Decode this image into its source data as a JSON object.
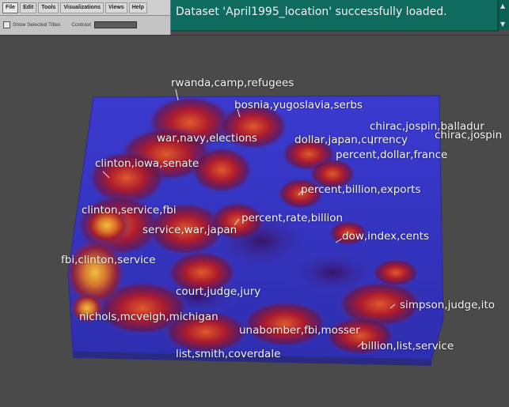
{
  "menubar": {
    "items": [
      {
        "label": "File"
      },
      {
        "label": "Edit"
      },
      {
        "label": "Tools"
      },
      {
        "label": "Visualizations"
      },
      {
        "label": "Views"
      },
      {
        "label": "Help"
      }
    ]
  },
  "options": {
    "show_selected_label": "Show Selected Titles",
    "contrast_label": "Contrast"
  },
  "status": {
    "message": "Dataset 'April1995_location' successfully loaded."
  },
  "scroll": {
    "up_icon": "▲",
    "down_icon": "▼"
  },
  "map": {
    "labels": [
      {
        "text": "rwanda,camp,refugees"
      },
      {
        "text": "bosnia,yugoslavia,serbs"
      },
      {
        "text": "chirac,jospin,balladur"
      },
      {
        "text": "chirac,jospin"
      },
      {
        "text": "war,navy,elections"
      },
      {
        "text": "dollar,japan,currency"
      },
      {
        "text": "percent,dollar,france"
      },
      {
        "text": "clinton,iowa,senate"
      },
      {
        "text": "percent,billion,exports"
      },
      {
        "text": "clinton,service,fbi"
      },
      {
        "text": "percent,rate,billion"
      },
      {
        "text": "service,war,japan"
      },
      {
        "text": "dow,index,cents"
      },
      {
        "text": "fbi,clinton,service"
      },
      {
        "text": "court,judge,jury"
      },
      {
        "text": "simpson,judge,ito"
      },
      {
        "text": "nichols,mcveigh,michigan"
      },
      {
        "text": "unabomber,fbi,mosser"
      },
      {
        "text": "billion,list,service"
      },
      {
        "text": "list,smith,coverdale"
      }
    ]
  },
  "colors": {
    "background": "#4a4a4a",
    "terrain_base": "#3c3cc8",
    "status_bar": "#0e6b5d",
    "peak_low": "#b21a26",
    "peak_high": "#e8b428"
  }
}
